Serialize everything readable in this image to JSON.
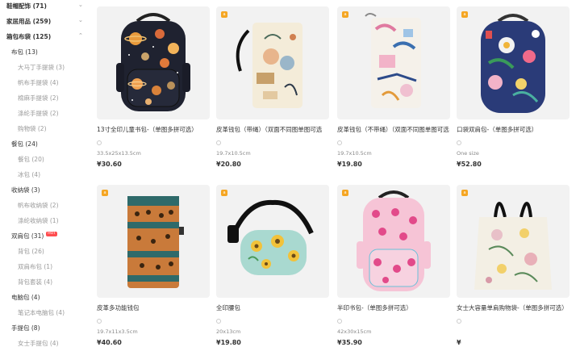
{
  "sidebar": {
    "categories": [
      {
        "label": "鞋帽配饰 (71)",
        "level": "top",
        "chevron": "⌄"
      },
      {
        "label": "家居用品 (259)",
        "level": "top",
        "chevron": "⌄"
      },
      {
        "label": "箱包布袋 (125)",
        "level": "top",
        "chevron": "⌃"
      },
      {
        "label": "布包 (13)",
        "level": "sub"
      },
      {
        "label": "大马丁手提袋 (3)",
        "level": "subsub"
      },
      {
        "label": "帆布手提袋 (4)",
        "level": "subsub"
      },
      {
        "label": "棉麻手提袋 (2)",
        "level": "subsub"
      },
      {
        "label": "涤纶手提袋 (2)",
        "level": "subsub"
      },
      {
        "label": "购物袋 (2)",
        "level": "subsub"
      },
      {
        "label": "餐包 (24)",
        "level": "sub"
      },
      {
        "label": "餐包 (20)",
        "level": "subsub"
      },
      {
        "label": "冰包 (4)",
        "level": "subsub"
      },
      {
        "label": "收纳袋 (3)",
        "level": "sub"
      },
      {
        "label": "帆布收纳袋 (2)",
        "level": "subsub"
      },
      {
        "label": "涤纶收纳袋 (1)",
        "level": "subsub"
      },
      {
        "label": "双肩包 (31)",
        "level": "sub",
        "badge": "HOT"
      },
      {
        "label": "背包 (26)",
        "level": "subsub"
      },
      {
        "label": "双肩布包 (1)",
        "level": "subsub"
      },
      {
        "label": "背包套装 (4)",
        "level": "subsub"
      },
      {
        "label": "电脑包 (4)",
        "level": "sub"
      },
      {
        "label": "笔记本电脑包 (4)",
        "level": "subsub"
      },
      {
        "label": "手提包 (8)",
        "level": "sub"
      },
      {
        "label": "女士手提包 (4)",
        "level": "subsub"
      }
    ]
  },
  "products": [
    {
      "title": "13寸全印儿童书包-（单图多拼可选）",
      "size": "33.5x25x13.5cm",
      "price": "¥30.60",
      "badge": false,
      "image": "planet-backpack"
    },
    {
      "title": "皮革钱包（带绳）（双面不同图单图可选",
      "size": "19.7x10.5cm",
      "price": "¥20.80",
      "badge": true,
      "image": "wristlet-wallet"
    },
    {
      "title": "皮革钱包（不带绳）（双面不同图单图可选",
      "size": "19.7x10.5cm",
      "price": "¥19.80",
      "badge": true,
      "image": "zip-wallet"
    },
    {
      "title": "口袋双肩包-（单图多拼可选）",
      "size": "One size",
      "price": "¥52.80",
      "badge": true,
      "image": "floral-backpack"
    },
    {
      "title": "皮革多功能钱包",
      "size": "19.7x11x3.5cm",
      "price": "¥40.60",
      "badge": true,
      "image": "leopard-wallet"
    },
    {
      "title": "全印腰包",
      "size": "20x13cm",
      "price": "¥19.80",
      "badge": true,
      "image": "sunflower-waistbag"
    },
    {
      "title": "半印书包-（单图多拼可选）",
      "size": "42x30x15cm",
      "price": "¥35.90",
      "badge": true,
      "image": "pink-leopard-backpack"
    },
    {
      "title": "女士大容量单肩购物袋-（单图多拼可选）",
      "size": "",
      "price": "¥",
      "badge": true,
      "image": "floral-tote"
    }
  ],
  "colors": {
    "accent": "#f5a623",
    "hot": "#ff4d4f",
    "card_bg": "#f2f2f2"
  }
}
